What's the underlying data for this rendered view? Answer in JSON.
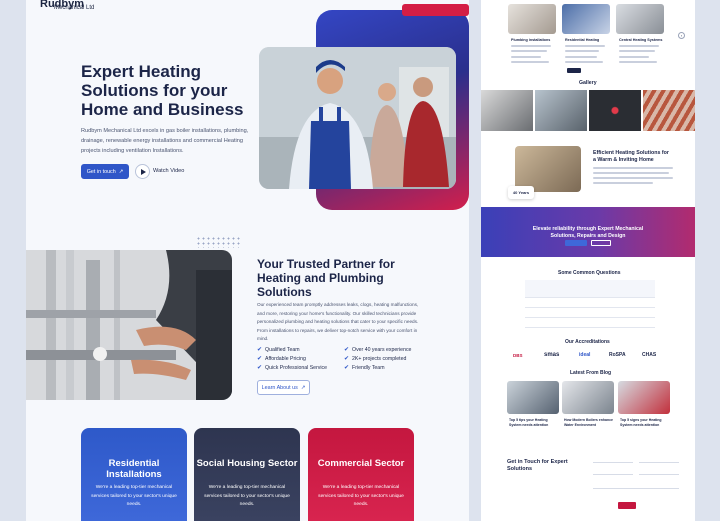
{
  "brand": {
    "name": "Rudbym",
    "sub": "Mechanical Ltd"
  },
  "hero": {
    "title": "Expert Heating Solutions for your Home and Business",
    "body": "Rudbym Mechanical Ltd excels in gas boiler installations, plumbing, drainage, renewable energy installations and commercial Heating projects including ventilation Installations.",
    "cta_label": "Get in touch",
    "watch_label": "Watch Video"
  },
  "about": {
    "title": "Your Trusted Partner for Heating and Plumbing Solutions",
    "body": "Our experienced team promptly addresses leaks, clogs, heating malfunctions, and more, restoring your home's functionality. Our skilled technicians provide personalized plumbing and heating solutions that cater to your specific needs. From installations to repairs, we deliver top-notch service with your comfort in mind.",
    "features": [
      "Qualified Team",
      "Over 40 years experience",
      "Affordable Pricing",
      "2K+ projects completed",
      "Quick Professional Service",
      "Friendly Team"
    ],
    "learn_more": "Learn About us"
  },
  "sectors": [
    {
      "title": "Residential Installations",
      "body": "We're a leading top-tier mechanical services tailored to your sector's unique needs."
    },
    {
      "title": "Social Housing Sector",
      "body": "We're a leading top-tier mechanical services tailored to your sector's unique needs."
    },
    {
      "title": "Commercial Sector",
      "body": "We're a leading top-tier mechanical services tailored to your sector's unique needs."
    }
  ],
  "preview": {
    "services": [
      "Plumbing installations",
      "Residential Heating",
      "Central Heating Systems"
    ],
    "gallery_title": "Gallery",
    "efficient_title": "Efficient Heating Solutions for a Warm & Inviting Home",
    "badge": "40 Years",
    "banner_title": "Elevate reliability through Expert Mechanical Solutions, Repairs and Design",
    "faq_title": "Some Common Questions",
    "accreditations_title": "Our Accreditations",
    "accreditations": [
      "DBS",
      "smas",
      "ideal",
      "RoSPA",
      "CHAS"
    ],
    "blog_title": "Latest From Blog",
    "blog_posts": [
      "Top 5 tips your Heating System needs attention",
      "How Modern Boilers enhance Water Environment",
      "Top 5 signs your Heating System needs attention"
    ],
    "contact_title": "Get in Touch for Expert Solutions"
  },
  "colors": {
    "primary": "#2f56c8",
    "navy": "#1c2548",
    "accent": "#c4173f"
  }
}
